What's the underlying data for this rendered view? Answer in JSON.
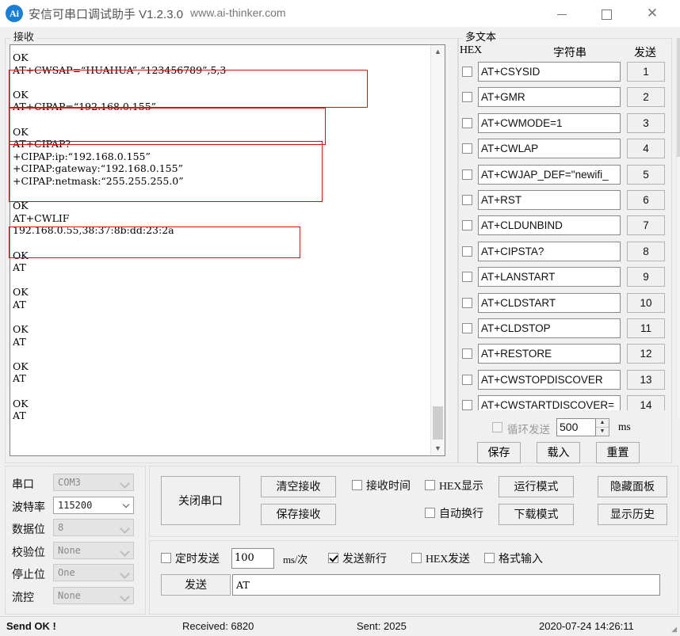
{
  "titlebar": {
    "icon": "app-logo-icon",
    "icon_text": "Ai",
    "title": "安信可串口调试助手 V1.2.3.0",
    "url": "www.ai-thinker.com",
    "minimize": "minimize-icon",
    "maximize": "maximize-icon",
    "close": "close-icon"
  },
  "receive": {
    "legend": "接收",
    "content": "OK\nAT+CWSAP=“HUAHUA”,“123456789”,5,3\n\nOK\nAT+CIPAP=“192.168.0.155”\n\nOK\nAT+CIPAP?\n+CIPAP:ip:“192.168.0.155”\n+CIPAP:gateway:“192.168.0.155”\n+CIPAP:netmask:“255.255.255.0”\n\nOK\nAT+CWLIF\n192.168.0.55,38:37:8b:dd:23:2a\n\nOK\nAT\n\nOK\nAT\n\nOK\nAT\n\nOK\nAT\n\nOK\nAT",
    "scroll_up": "scroll-up-icon",
    "scroll_down": "scroll-down-icon",
    "annotation_color": "#e8000b"
  },
  "multitext": {
    "legend": "多文本",
    "header_hex": "HEX",
    "header_string": "字符串",
    "header_send": "发送",
    "rows": [
      {
        "hex": false,
        "cmd": "AT+CSYSID",
        "num": "1"
      },
      {
        "hex": false,
        "cmd": "AT+GMR",
        "num": "2"
      },
      {
        "hex": false,
        "cmd": "AT+CWMODE=1",
        "num": "3"
      },
      {
        "hex": false,
        "cmd": "AT+CWLAP",
        "num": "4"
      },
      {
        "hex": false,
        "cmd": "AT+CWJAP_DEF=\"newifi_",
        "num": "5"
      },
      {
        "hex": false,
        "cmd": "AT+RST",
        "num": "6"
      },
      {
        "hex": false,
        "cmd": "AT+CLDUNBIND",
        "num": "7"
      },
      {
        "hex": false,
        "cmd": "AT+CIPSTA?",
        "num": "8"
      },
      {
        "hex": false,
        "cmd": "AT+LANSTART",
        "num": "9"
      },
      {
        "hex": false,
        "cmd": "AT+CLDSTART",
        "num": "10"
      },
      {
        "hex": false,
        "cmd": "AT+CLDSTOP",
        "num": "11"
      },
      {
        "hex": false,
        "cmd": "AT+RESTORE",
        "num": "12"
      },
      {
        "hex": false,
        "cmd": "AT+CWSTOPDISCOVER",
        "num": "13"
      },
      {
        "hex": false,
        "cmd": "AT+CWSTARTDISCOVER=",
        "num": "14"
      }
    ],
    "loop_send_label": "循环发送",
    "loop_send_checked": false,
    "loop_interval": "500",
    "loop_unit": "ms",
    "save_label": "保存",
    "load_label": "载入",
    "reset_label": "重置"
  },
  "serial": {
    "rows": [
      {
        "label": "串口",
        "value": "COM3",
        "active": false
      },
      {
        "label": "波特率",
        "value": "115200",
        "active": true
      },
      {
        "label": "数据位",
        "value": "8",
        "active": false
      },
      {
        "label": "校验位",
        "value": "None",
        "active": false
      },
      {
        "label": "停止位",
        "value": "One",
        "active": false
      },
      {
        "label": "流控",
        "value": "None",
        "active": false
      }
    ]
  },
  "controls": {
    "close_port": "关闭串口",
    "clear_receive": "清空接收",
    "save_receive": "保存接收",
    "recv_time_label": "接收时间",
    "recv_time_checked": false,
    "hex_display_label": "HEX显示",
    "hex_display_checked": false,
    "auto_wrap_label": "自动换行",
    "auto_wrap_checked": false,
    "run_mode": "运行模式",
    "download_mode": "下载模式",
    "hide_panel": "隐藏面板",
    "show_history": "显示历史"
  },
  "send": {
    "timer_send_label": "定时发送",
    "timer_send_checked": false,
    "timer_value": "100",
    "timer_unit": "ms/次",
    "send_newline_label": "发送新行",
    "send_newline_checked": true,
    "hex_send_label": "HEX发送",
    "hex_send_checked": false,
    "format_input_label": "格式输入",
    "format_input_checked": false,
    "send_button": "发送",
    "send_text": "AT"
  },
  "status": {
    "message": "Send OK !",
    "received": "Received: 6820",
    "sent": "Sent: 2025",
    "datetime": "2020-07-24 14:26:11"
  }
}
